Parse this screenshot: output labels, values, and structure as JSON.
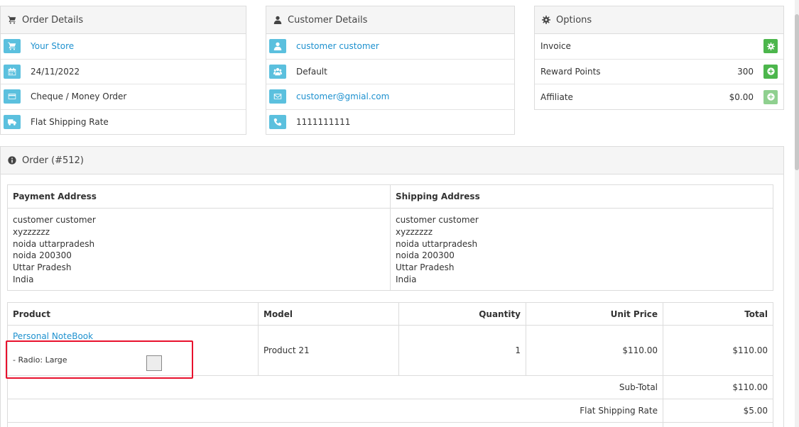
{
  "order_details": {
    "title": "Order Details",
    "store": "Your Store",
    "date": "24/11/2022",
    "payment_method": "Cheque / Money Order",
    "shipping_method": "Flat Shipping Rate"
  },
  "customer_details": {
    "title": "Customer Details",
    "name": "customer customer",
    "group": "Default",
    "email": "customer@gmial.com",
    "phone": "1111111111"
  },
  "options": {
    "title": "Options",
    "invoice_label": "Invoice",
    "reward_label": "Reward Points",
    "reward_value": "300",
    "affiliate_label": "Affiliate",
    "affiliate_value": "$0.00"
  },
  "order": {
    "title": "Order (#512)",
    "payment_address_header": "Payment Address",
    "shipping_address_header": "Shipping Address",
    "payment_address": [
      "customer customer",
      "xyzzzzzz",
      "noida uttarpradesh",
      "noida 200300",
      "Uttar Pradesh",
      "India"
    ],
    "shipping_address": [
      "customer customer",
      "xyzzzzzz",
      "noida uttarpradesh",
      "noida 200300",
      "Uttar Pradesh",
      "India"
    ],
    "columns": {
      "product": "Product",
      "model": "Model",
      "quantity": "Quantity",
      "unit_price": "Unit Price",
      "total": "Total"
    },
    "item": {
      "name": "Personal NoteBook",
      "option": "- Radio: Large",
      "model": "Product 21",
      "quantity": "1",
      "unit_price": "$110.00",
      "total": "$110.00"
    },
    "totals": [
      {
        "label": "Sub-Total",
        "value": "$110.00"
      },
      {
        "label": "Flat Shipping Rate",
        "value": "$5.00"
      }
    ]
  },
  "colors": {
    "info": "#5bc0de",
    "success": "#4cb64c",
    "link": "#1e91cf",
    "highlight": "#e8112d"
  }
}
